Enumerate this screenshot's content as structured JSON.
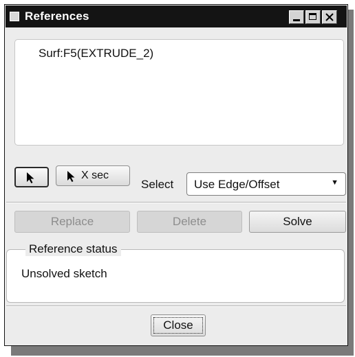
{
  "window": {
    "title": "References",
    "controls": [
      "minimize-icon",
      "maximize-icon",
      "close-icon"
    ]
  },
  "references": {
    "items": [
      "Surf:F5(EXTRUDE_2)"
    ]
  },
  "tools": {
    "pick_icon": "arrow-pointer-icon",
    "xsec_label": "X sec"
  },
  "select": {
    "label": "Select",
    "value": "Use Edge/Offset"
  },
  "actions": {
    "replace": "Replace",
    "delete": "Delete",
    "solve": "Solve"
  },
  "status": {
    "legend": "Reference status",
    "text": "Unsolved sketch"
  },
  "footer": {
    "close": "Close"
  },
  "colors": {
    "titlebar": "#141414",
    "dialog_bg": "#ececec",
    "disabled_text": "#8d8d8d"
  }
}
